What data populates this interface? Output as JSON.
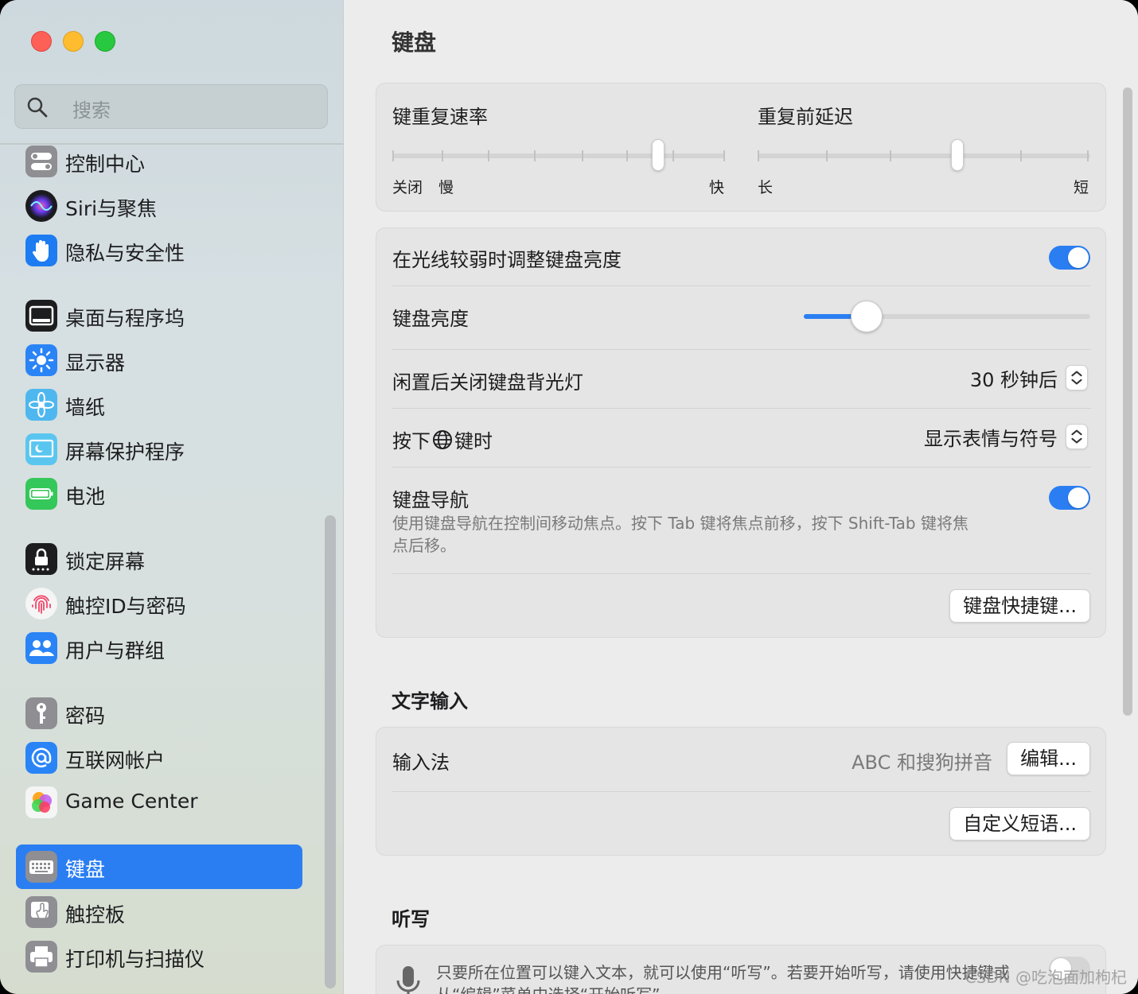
{
  "sidebar": {
    "search_placeholder": "搜索",
    "items": [
      {
        "label": "控制中心",
        "icon": "control-center-icon",
        "color": "#8e8e93"
      },
      {
        "label": "Siri与聚焦",
        "icon": "siri-icon",
        "color": "#5b3ccc"
      },
      {
        "label": "隐私与安全性",
        "icon": "hand-icon",
        "color": "#1d7cf2"
      },
      {
        "label": "桌面与程序坞",
        "icon": "dock-icon",
        "color": "#1d1d1f"
      },
      {
        "label": "显示器",
        "icon": "sun-icon",
        "color": "#2a84f6"
      },
      {
        "label": "墙纸",
        "icon": "flower-icon",
        "color": "#4fb7ef"
      },
      {
        "label": "屏幕保护程序",
        "icon": "screensaver-icon",
        "color": "#5ac6f0"
      },
      {
        "label": "电池",
        "icon": "battery-icon",
        "color": "#34c759"
      },
      {
        "label": "锁定屏幕",
        "icon": "lock-icon",
        "color": "#1d1d1f"
      },
      {
        "label": "触控ID与密码",
        "icon": "fingerprint-icon",
        "color": "#f2f2f2"
      },
      {
        "label": "用户与群组",
        "icon": "users-icon",
        "color": "#2a84f6"
      },
      {
        "label": "密码",
        "icon": "key-icon",
        "color": "#8e8e93"
      },
      {
        "label": "互联网帐户",
        "icon": "at-icon",
        "color": "#2a84f6"
      },
      {
        "label": "Game Center",
        "icon": "game-center-icon",
        "color": "#f2f2f2"
      },
      {
        "label": "键盘",
        "icon": "keyboard-icon",
        "color": "#8e8e93"
      },
      {
        "label": "触控板",
        "icon": "trackpad-icon",
        "color": "#8e8e93"
      },
      {
        "label": "打印机与扫描仪",
        "icon": "printer-icon",
        "color": "#8e8e93"
      }
    ]
  },
  "main": {
    "title": "键盘",
    "repeat": {
      "label": "键重复速率",
      "left_label_off": "关闭",
      "left_label_slow": "慢",
      "right_label": "快",
      "value_fraction": 0.8
    },
    "delay": {
      "label": "重复前延迟",
      "left_label": "长",
      "right_label": "短",
      "value_fraction": 0.6
    },
    "adjust_brightness_label": "在光线较弱时调整键盘亮度",
    "brightness_label": "键盘亮度",
    "brightness_fraction": 0.22,
    "idle_label": "闲置后关闭键盘背光灯",
    "idle_value": "30 秒钟后",
    "globe_label_pre": "按下",
    "globe_label_post": "键时",
    "globe_value": "显示表情与符号",
    "nav_label": "键盘导航",
    "nav_desc_line1": "使用键盘导航在控制间移动焦点。按下 Tab 键将焦点前移，按下 Shift-Tab 键将焦",
    "nav_desc_line2": "点后移。",
    "shortcuts_button": "键盘快捷键...",
    "text_input_title": "文字输入",
    "input_method_label": "输入法",
    "input_method_value": "ABC 和搜狗拼音",
    "edit_button": "编辑...",
    "custom_phrases_button": "自定义短语...",
    "dictation_title": "听写",
    "dictation_desc_line1": "只要所在位置可以键入文本，就可以使用“听写”。若要开始听写，请使用快捷键或",
    "dictation_desc_line2": "从“编辑”菜单中选择“开始听写”。",
    "watermark": "CSDN @吃泡面加枸杞"
  },
  "colors": {
    "accent": "#2a7ef2",
    "toggle_on": "#2a7ef2"
  }
}
